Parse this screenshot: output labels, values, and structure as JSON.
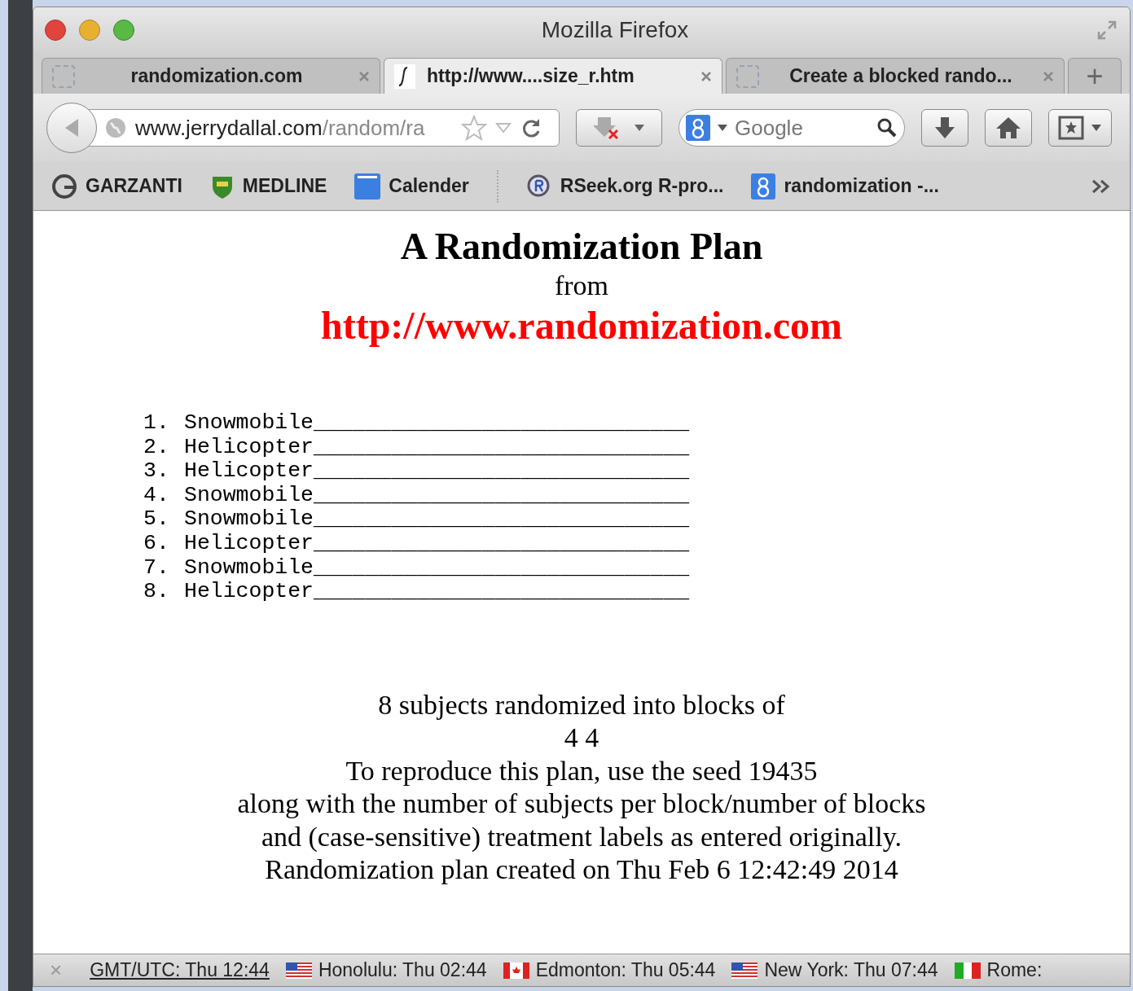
{
  "window": {
    "title": "Mozilla Firefox"
  },
  "tabs": [
    {
      "label": "randomization.com",
      "selected": false
    },
    {
      "label": "http://www....size_r.htm",
      "selected": true
    },
    {
      "label": "Create a blocked rando...",
      "selected": false
    }
  ],
  "new_tab": "+",
  "address_bar": {
    "host": "www.jerrydallal.com",
    "path": "/random/ra"
  },
  "search": {
    "placeholder": "Google"
  },
  "bookmarks": [
    {
      "label": "GARZANTI"
    },
    {
      "label": "MEDLINE"
    },
    {
      "label": "Calender"
    },
    {
      "label": "RSeek.org R-pro..."
    },
    {
      "label": "randomization -..."
    }
  ],
  "page": {
    "title": "A Randomization Plan",
    "from": "from",
    "link": "http://www.randomization.com",
    "plan": [
      {
        "number": "1.",
        "text": "Snowmobile_____________________________"
      },
      {
        "number": "2.",
        "text": "Helicopter_____________________________"
      },
      {
        "number": "3.",
        "text": "Helicopter_____________________________"
      },
      {
        "number": "4.",
        "text": "Snowmobile_____________________________"
      },
      {
        "number": "5.",
        "text": "Snowmobile_____________________________"
      },
      {
        "number": "6.",
        "text": "Helicopter_____________________________"
      },
      {
        "number": "7.",
        "text": "Snowmobile_____________________________"
      },
      {
        "number": "8.",
        "text": "Helicopter_____________________________"
      }
    ],
    "notes": [
      "8 subjects randomized into blocks of",
      "4 4",
      "To reproduce this plan, use the seed 19435",
      "along with the number of subjects per block/number of blocks",
      "and (case-sensitive) treatment labels as entered originally.",
      "Randomization plan created on Thu Feb 6 12:42:49 2014"
    ]
  },
  "status_bar": {
    "close": "×",
    "clocks": [
      {
        "label": "GMT/UTC: Thu 12:44"
      },
      {
        "label": "Honolulu: Thu 02:44"
      },
      {
        "label": "Edmonton: Thu 05:44"
      },
      {
        "label": "New York: Thu 07:44"
      },
      {
        "label": "Rome:"
      }
    ]
  }
}
